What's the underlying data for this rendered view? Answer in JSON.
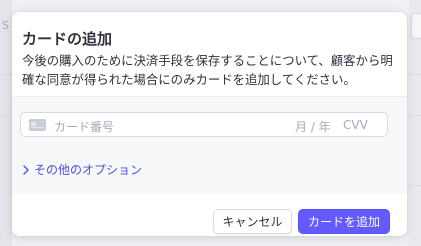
{
  "background": {
    "glyph": "S"
  },
  "modal": {
    "title": "カードの追加",
    "description": "今後の購入のために決済手段を保存することについて、顧客から明確な同意が得られた場合にのみカードを追加してください。"
  },
  "card_form": {
    "card_number_placeholder": "カード番号",
    "expiry_placeholder": "月 / 年",
    "cvv_placeholder": "CVV",
    "card_icon": "credit-card-icon"
  },
  "more_options": {
    "label": "その他のオプション",
    "icon": "chevron-right-icon"
  },
  "footer": {
    "cancel_label": "キャンセル",
    "add_label": "カードを追加"
  },
  "colors": {
    "accent": "#635bff",
    "link": "#4b52d6",
    "text": "#30313d",
    "placeholder": "#a3acba"
  }
}
